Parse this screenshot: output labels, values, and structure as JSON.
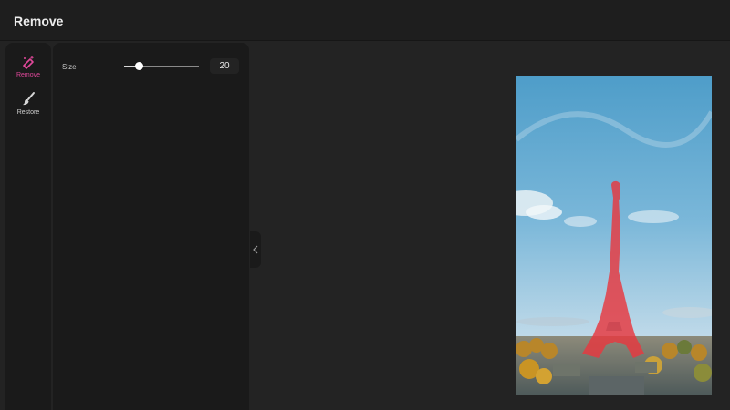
{
  "header": {
    "title": "Remove"
  },
  "tools": [
    {
      "label": "Remove",
      "icon": "magic-eraser-icon",
      "active": true
    },
    {
      "label": "Restore",
      "icon": "brush-icon",
      "active": false
    }
  ],
  "panel": {
    "size_label": "Size",
    "size_value": "20",
    "size_fraction": 0.2
  },
  "colors": {
    "accent": "#e0489a",
    "mask": "#e8383f",
    "background": "#232323",
    "panel": "#1a1a1a"
  },
  "collapse_icon": "chevron-left-icon"
}
